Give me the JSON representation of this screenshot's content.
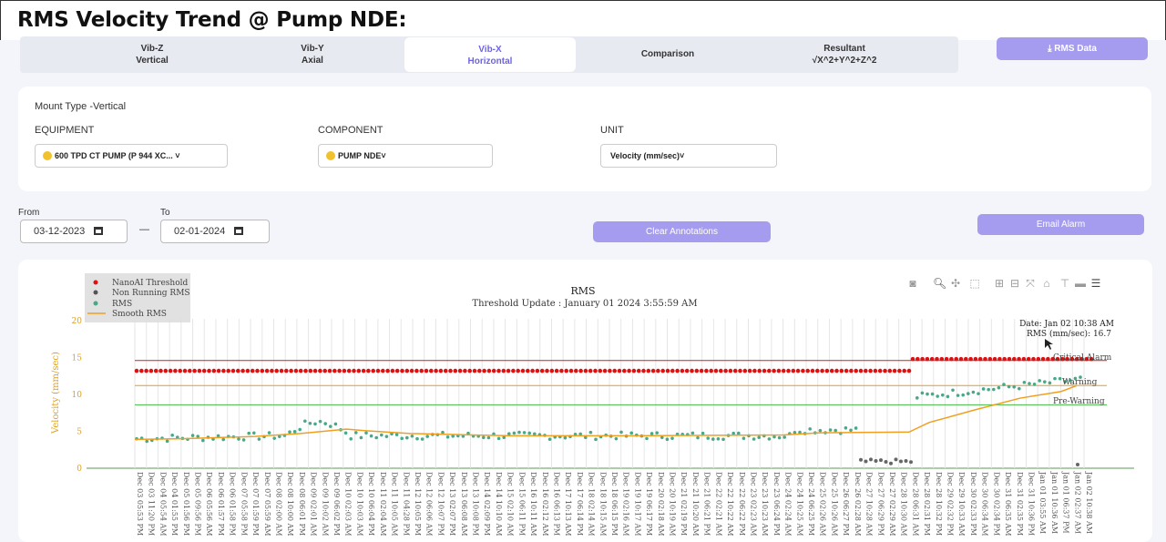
{
  "page": {
    "title": "RMS Velocity Trend @ Pump NDE:"
  },
  "tabs": [
    {
      "line1": "Vib-Z",
      "line2": "Vertical"
    },
    {
      "line1": "Vib-Y",
      "line2": "Axial"
    },
    {
      "line1": "Vib-X",
      "line2": "Horizontal"
    },
    {
      "line1": "Comparison",
      "line2": ""
    },
    {
      "line1": "Resultant",
      "line2": "√X^2+Y^2+Z^2"
    }
  ],
  "rms_data_button": "⤓ RMS Data",
  "filters": {
    "mount_type": "Mount Type -Vertical",
    "equipment_label": "EQUIPMENT",
    "equipment_value": "600 TPD CT PUMP (P 944 XC...",
    "component_label": "COMPONENT",
    "component_value": "PUMP NDE",
    "unit_label": "UNIT",
    "unit_value": "Velocity (mm/sec)"
  },
  "dates": {
    "from_label": "From",
    "from_value": "03-12-2023",
    "to_label": "To",
    "to_value": "02-01-2024",
    "separator": "—"
  },
  "buttons": {
    "clear_annotations": "Clear Annotations",
    "email_alarm": "Email Alarm"
  },
  "chart_data": {
    "type": "scatter",
    "title": "RMS",
    "subtitle": "Threshold Update : January 01 2024 3:55:59 AM",
    "ylabel": "Velocity (mm/sec)",
    "ylim": [
      0,
      20
    ],
    "yticks": [
      0,
      5,
      10,
      15,
      20
    ],
    "legend": [
      "NanoAI Threshold",
      "Non Running RMS",
      "RMS",
      "Smooth RMS"
    ],
    "legend_placement": "top-left",
    "thresholds": [
      {
        "name": "Critical Alarm",
        "value": 14.6,
        "color": "#cc2222"
      },
      {
        "name": "Warning",
        "value": 11.2,
        "color": "#e0a020"
      },
      {
        "name": "Pre-Warning",
        "value": 8.6,
        "color": "#44bb44"
      }
    ],
    "threshold_labels": {
      "critical": "Critical Alarm",
      "warning": "Warning",
      "pre_warning": "Pre-Warning"
    },
    "hover": {
      "date": "Date: Jan 02  10:38 AM",
      "value": "RMS (mm/sec): 16.7"
    },
    "nanoai_threshold": {
      "segment1_value": 13.2,
      "segment2_value": 14.8
    },
    "x_labels": [
      "Dec 03 05:53 PM",
      "Dec 03 11:20 PM",
      "Dec 04 05:54 AM",
      "Dec 04 01:55 PM",
      "Dec 05 01:56 PM",
      "Dec 05 09:56 PM",
      "Dec 06 05:56 AM",
      "Dec 06 01:57 PM",
      "Dec 06 01:58 PM",
      "Dec 07 05:58 PM",
      "Dec 07 01:59 PM",
      "Dec 07 05:59 AM",
      "Dec 08 02:00 AM",
      "Dec 08 10:00 AM",
      "Dec 08 06:01 PM",
      "Dec 09 02:01 AM",
      "Dec 09 10:02 AM",
      "Dec 09 06:02 PM",
      "Dec 10 02:03 AM",
      "Dec 10 10:03 AM",
      "Dec 10 06:04 PM",
      "Dec 11 02:04 AM",
      "Dec 11 10:05 AM",
      "Dec 11 04:28 PM",
      "Dec 12 10:05 PM",
      "Dec 12 06:06 AM",
      "Dec 12 10:07 PM",
      "Dec 13 02:07 PM",
      "Dec 13 06:08 AM",
      "Dec 13 10:08 PM",
      "Dec 14 02:09 PM",
      "Dec 14 10:10 AM",
      "Dec 15 02:10 AM",
      "Dec 15 06:11 PM",
      "Dec 16 10:11 AM",
      "Dec 16 02:12 AM",
      "Dec 16 06:13 PM",
      "Dec 17 10:13 AM",
      "Dec 17 06:14 PM",
      "Dec 18 02:14 AM",
      "Dec 18 10:15 AM",
      "Dec 18 06:15 PM",
      "Dec 19 02:16 AM",
      "Dec 19 10:17 AM",
      "Dec 19 06:17 PM",
      "Dec 20 02:18 AM",
      "Dec 20 10:19 AM",
      "Dec 21 02:19 PM",
      "Dec 21 10:20 AM",
      "Dec 21 06:21 PM",
      "Dec 22 02:21 AM",
      "Dec 22 10:22 AM",
      "Dec 22 06:22 PM",
      "Dec 23 02:23 AM",
      "Dec 23 10:23 AM",
      "Dec 23 06:24 PM",
      "Dec 24 02:24 AM",
      "Dec 24 10:25 AM",
      "Dec 24 06:25 PM",
      "Dec 25 02:26 AM",
      "Dec 25 10:26 AM",
      "Dec 26 06:27 PM",
      "Dec 26 02:28 AM",
      "Dec 27 10:28 AM",
      "Dec 27 06:29 PM",
      "Dec 27 02:29 AM",
      "Dec 28 10:30 AM",
      "Dec 28 06:31 AM",
      "Dec 28 02:31 PM",
      "Dec 28 10:32 PM",
      "Dec 29 02:32 PM",
      "Dec 29 10:33 AM",
      "Dec 30 02:33 PM",
      "Dec 30 06:34 AM",
      "Dec 30 02:34 PM",
      "Dec 31 06:35 AM",
      "Dec 31 02:35 PM",
      "Dec 31 10:36 PM",
      "Jan 01 03:55 AM",
      "Jan 01 10:36 AM",
      "Jan 01 06:37 PM",
      "Jan 02 02:37 AM",
      "Jan 02 10:38 AM"
    ]
  }
}
